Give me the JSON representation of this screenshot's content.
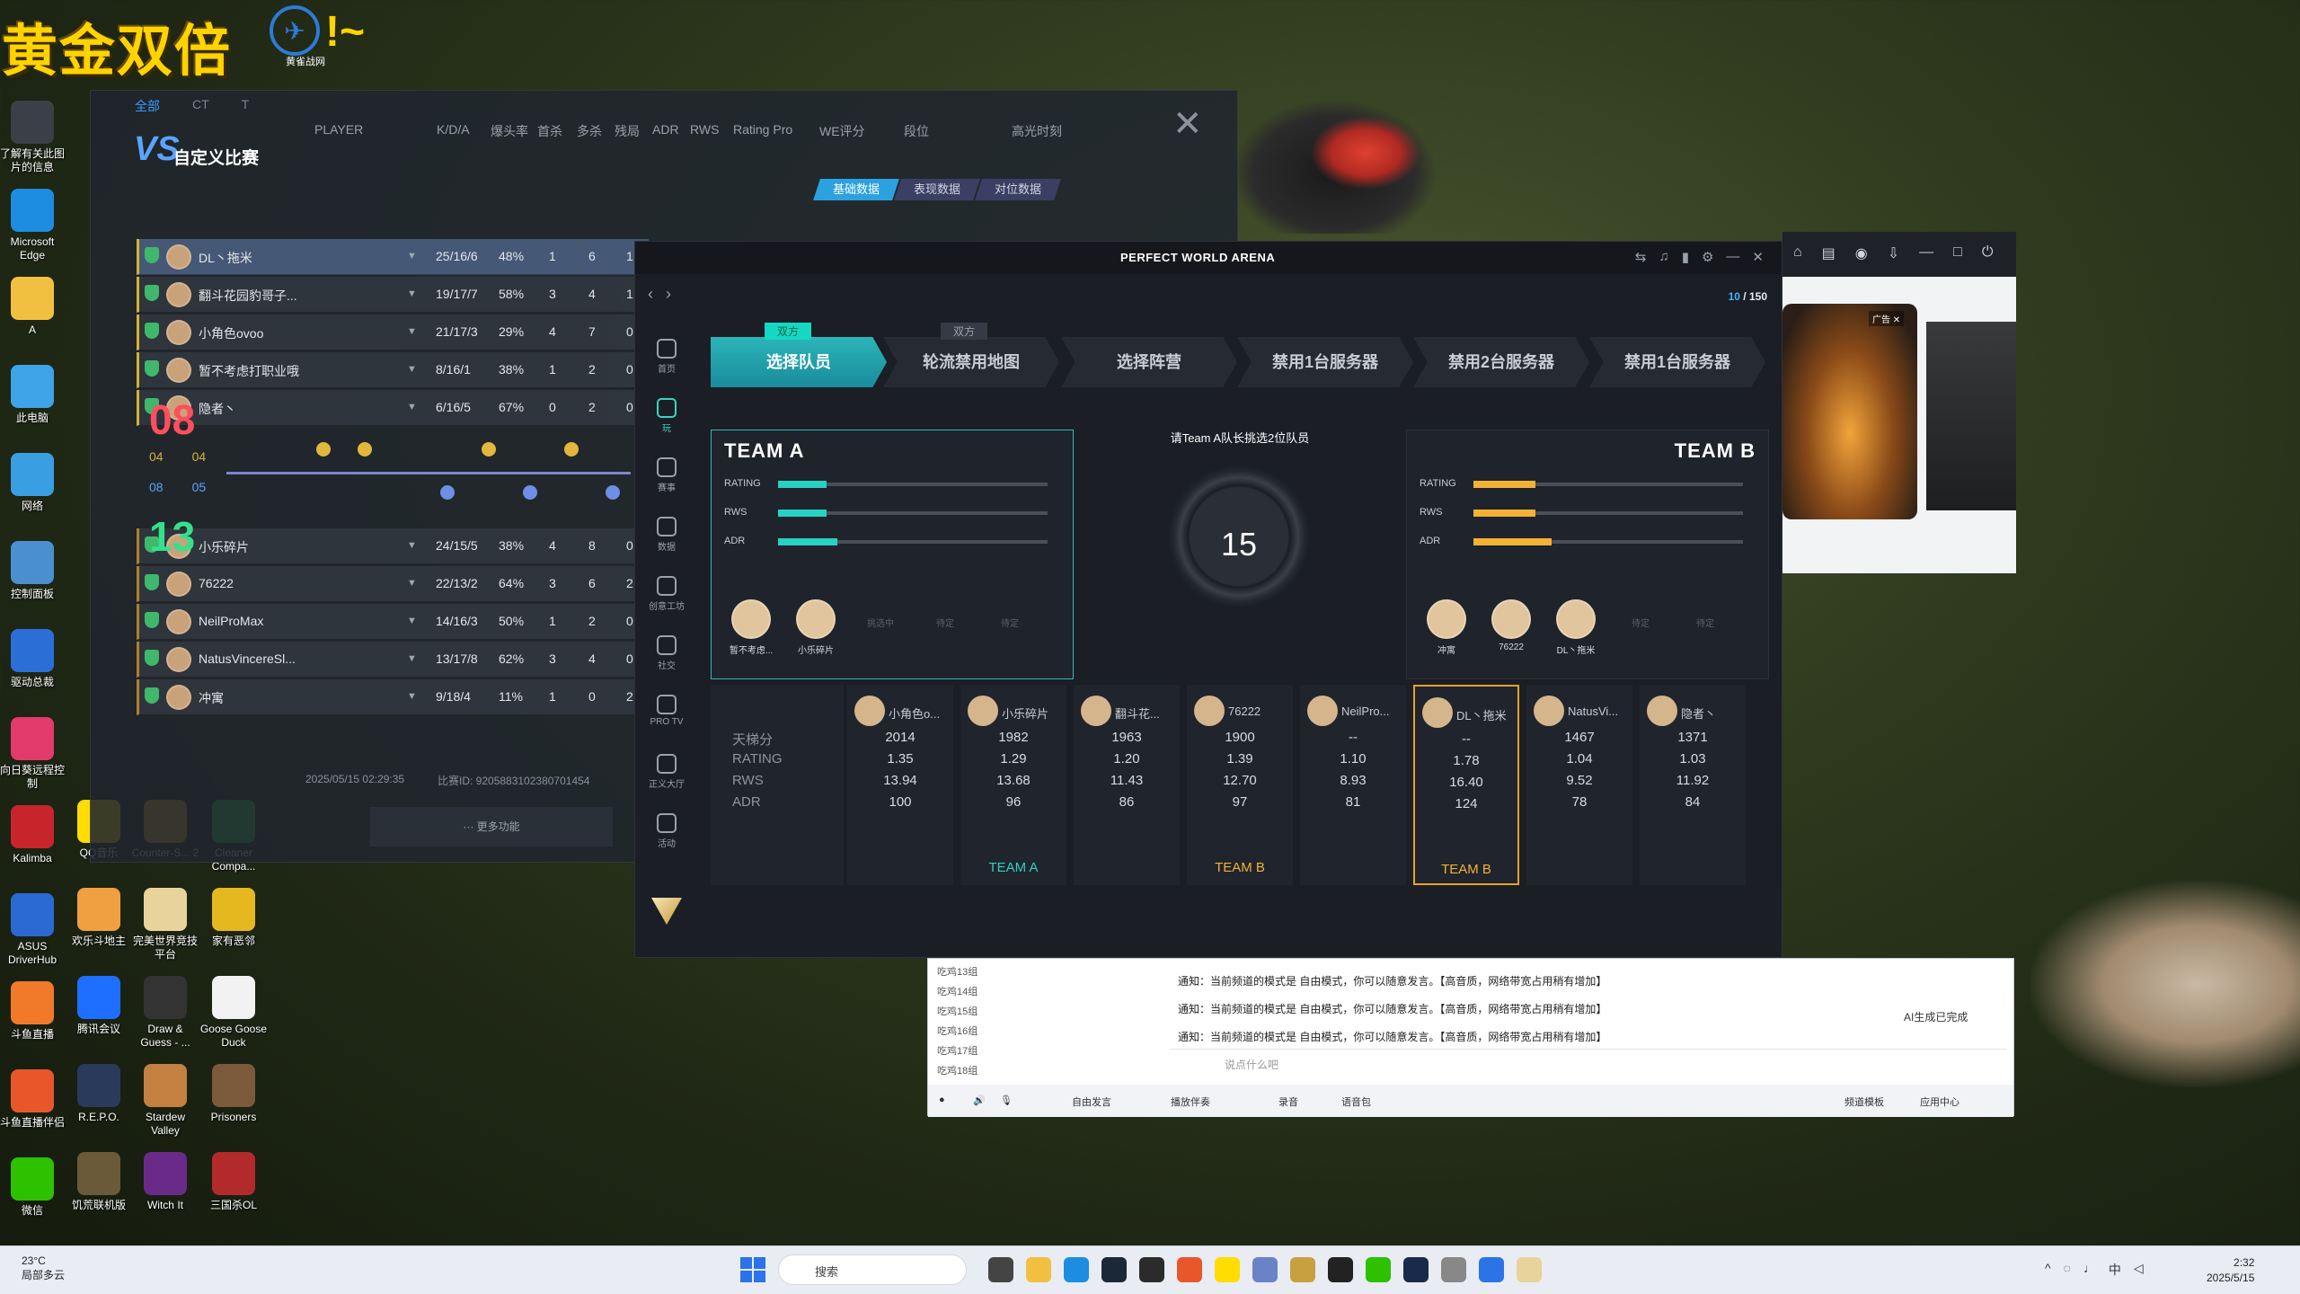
{
  "overlay": {
    "title": "黄金双倍",
    "tilde": "!~",
    "logo_sub": "黄雀战网"
  },
  "desktop_icons": [
    {
      "label": "了解有关此图片的信息",
      "icon": "info-icon",
      "color": "#3a3f48"
    },
    {
      "label": "Microsoft Edge",
      "icon": "edge-icon",
      "color": "#1c8de0"
    },
    {
      "label": "A",
      "icon": "folder-icon",
      "color": "#f2c040"
    },
    {
      "label": "此电脑",
      "icon": "computer-icon",
      "color": "#3fa3e8"
    },
    {
      "label": "网络",
      "icon": "network-icon",
      "color": "#3a9ee2"
    },
    {
      "label": "控制面板",
      "icon": "control-panel-icon",
      "color": "#4a8fd0"
    },
    {
      "label": "驱动总裁",
      "icon": "driver-icon",
      "color": "#2b6fd6"
    },
    {
      "label": "向日葵远程控制",
      "icon": "sunflower-icon",
      "color": "#e23a6a"
    },
    {
      "label": "Kalimba",
      "icon": "kalimba-icon",
      "color": "#c8242c"
    },
    {
      "label": "ASUS DriverHub",
      "icon": "asus-icon",
      "color": "#2a6ad2"
    },
    {
      "label": "斗鱼直播",
      "icon": "douyu-icon",
      "color": "#f07a2a"
    },
    {
      "label": "斗鱼直播伴侣",
      "icon": "douyu-companion-icon",
      "color": "#e8572a"
    },
    {
      "label": "微信",
      "icon": "wechat-icon",
      "color": "#2dc100"
    }
  ],
  "desktop_icons_col2": [
    {
      "label": "QQ音乐",
      "icon": "qqmusic-icon",
      "color": "#ffdd00"
    },
    {
      "label": "欢乐斗地主",
      "icon": "landlord-icon",
      "color": "#f0a040"
    },
    {
      "label": "腾讯会议",
      "icon": "meeting-icon",
      "color": "#1e6fff"
    },
    {
      "label": "R.E.P.O.",
      "icon": "repo-icon",
      "color": "#2a3a5a"
    },
    {
      "label": "饥荒联机版",
      "icon": "dst-icon",
      "color": "#6a5a3a"
    }
  ],
  "desktop_icons_col3": [
    {
      "label": "Counter-S... 2",
      "icon": "cs2-icon",
      "color": "#e4a020"
    },
    {
      "label": "完美世界竞技平台",
      "icon": "pwa-icon",
      "color": "#e8d49a"
    },
    {
      "label": "Draw & Guess - ...",
      "icon": "drawguess-icon",
      "color": "#333"
    },
    {
      "label": "Stardew Valley",
      "icon": "stardew-icon",
      "color": "#c48040"
    },
    {
      "label": "Witch It",
      "icon": "witchit-icon",
      "color": "#6a2a8a"
    }
  ],
  "desktop_icons_col4": [
    {
      "label": "Cleaner Compa...",
      "icon": "cleaner-icon",
      "color": "#36c24a"
    },
    {
      "label": "家有恶邻",
      "icon": "neighbor-icon",
      "color": "#e6b820"
    },
    {
      "label": "Goose Goose Duck",
      "icon": "goose-icon",
      "color": "#f2f2f2"
    },
    {
      "label": "Prisoners",
      "icon": "prisoners-icon",
      "color": "#7a5a3a"
    },
    {
      "label": "三国杀OL",
      "icon": "sgs-icon",
      "color": "#b22a2a"
    }
  ],
  "scoreboard": {
    "logo_text": "自定义比赛",
    "tabs": [
      "基础数据",
      "表现数据",
      "对位数据"
    ],
    "filters": [
      "全部",
      "CT",
      "T"
    ],
    "headers": {
      "player": "PLAYER",
      "kda": "K/D/A",
      "hs": "爆头率",
      "fk": "首杀",
      "mk": "多杀",
      "clutch": "残局",
      "adr": "ADR",
      "rws": "RWS",
      "rating": "Rating Pro",
      "we": "WE评分",
      "rank": "段位",
      "highlight": "高光时刻"
    },
    "team_a_rows": [
      {
        "name": "DL丶拖米",
        "kda": "25/16/6",
        "hs": "48%",
        "fk": "1",
        "mk": "6",
        "clutch": "1"
      },
      {
        "name": "翻斗花园豹哥子...",
        "kda": "19/17/7",
        "hs": "58%",
        "fk": "3",
        "mk": "4",
        "clutch": "1"
      },
      {
        "name": "小角色ovoo",
        "kda": "21/17/3",
        "hs": "29%",
        "fk": "4",
        "mk": "7",
        "clutch": "0"
      },
      {
        "name": "暂不考虑打职业哦",
        "kda": "8/16/1",
        "hs": "38%",
        "fk": "1",
        "mk": "2",
        "clutch": "0"
      },
      {
        "name": "隐者丶",
        "kda": "6/16/5",
        "hs": "67%",
        "fk": "0",
        "mk": "2",
        "clutch": "0"
      }
    ],
    "team_b_rows": [
      {
        "name": "小乐碎片",
        "kda": "24/15/5",
        "hs": "38%",
        "fk": "4",
        "mk": "8",
        "clutch": "0"
      },
      {
        "name": "76222",
        "kda": "22/13/2",
        "hs": "64%",
        "fk": "3",
        "mk": "6",
        "clutch": "2"
      },
      {
        "name": "NeilProMax",
        "kda": "14/16/3",
        "hs": "50%",
        "fk": "1",
        "mk": "2",
        "clutch": "0"
      },
      {
        "name": "NatusVincereSl...",
        "kda": "13/17/8",
        "hs": "62%",
        "fk": "3",
        "mk": "4",
        "clutch": "0"
      },
      {
        "name": "冲寓",
        "kda": "9/18/4",
        "hs": "11%",
        "fk": "1",
        "mk": "0",
        "clutch": "2"
      }
    ],
    "score_a": "08",
    "score_b": "13",
    "half_a": [
      "04",
      "04"
    ],
    "half_b": [
      "08",
      "05"
    ],
    "date": "2025/05/15 02:29:35",
    "match_id": "比赛ID: 9205883102380701454",
    "more": "··· 更多功能"
  },
  "arena": {
    "title": "PERFECT WORLD ARENA",
    "counter_current": "10",
    "counter_total": "/ 150",
    "sidebar": [
      {
        "label": "首页",
        "icon": "home-icon"
      },
      {
        "label": "玩",
        "icon": "play-icon"
      },
      {
        "label": "赛事",
        "icon": "trophy-icon"
      },
      {
        "label": "数据",
        "icon": "data-icon"
      },
      {
        "label": "创意工坊",
        "icon": "workshop-icon"
      },
      {
        "label": "社交",
        "icon": "social-icon"
      },
      {
        "label": "PRO TV",
        "icon": "tv-icon"
      },
      {
        "label": "正义大厅",
        "icon": "justice-icon"
      },
      {
        "label": "活动",
        "icon": "event-icon"
      }
    ],
    "stages": [
      "选择队员",
      "轮流禁用地图",
      "选择阵营",
      "禁用1台服务器",
      "禁用2台服务器",
      "禁用1台服务器"
    ],
    "stage_badge_active": "双方",
    "stage_badge_next": "双方",
    "team_a": {
      "label": "TEAM A",
      "stats": [
        {
          "label": "RATING",
          "value": 0.18
        },
        {
          "label": "RWS",
          "value": 0.18
        },
        {
          "label": "ADR",
          "value": 0.22
        }
      ],
      "slots": [
        "暂不考虑...",
        "小乐碎片",
        "挑选中",
        "待定",
        "待定"
      ]
    },
    "team_b": {
      "label": "TEAM B",
      "stats": [
        {
          "label": "RATING",
          "value": 0.23
        },
        {
          "label": "RWS",
          "value": 0.23
        },
        {
          "label": "ADR",
          "value": 0.29
        }
      ],
      "slots": [
        "冲寓",
        "76222",
        "DL丶拖米",
        "待定",
        "待定"
      ]
    },
    "prompt": "请Team A队长挑选2位队员",
    "timer": "15",
    "stat_labels": [
      "天梯分",
      "RATING",
      "RWS",
      "ADR"
    ],
    "players": [
      {
        "name": "小角色o...",
        "elo": "2014",
        "rating": "1.35",
        "rws": "13.94",
        "adr": "100",
        "team": "",
        "team_color": ""
      },
      {
        "name": "小乐碎片",
        "elo": "1982",
        "rating": "1.29",
        "rws": "13.68",
        "adr": "96",
        "team": "TEAM A",
        "team_color": "#2fd0c4"
      },
      {
        "name": "翻斗花...",
        "elo": "1963",
        "rating": "1.20",
        "rws": "11.43",
        "adr": "86",
        "team": "",
        "team_color": ""
      },
      {
        "name": "76222",
        "elo": "1900",
        "rating": "1.39",
        "rws": "12.70",
        "adr": "97",
        "team": "TEAM B",
        "team_color": "#f2b233"
      },
      {
        "name": "NeilPro...",
        "elo": "--",
        "rating": "1.10",
        "rws": "8.93",
        "adr": "81",
        "team": "",
        "team_color": ""
      },
      {
        "name": "DL丶拖米",
        "elo": "--",
        "rating": "1.78",
        "rws": "16.40",
        "adr": "124",
        "team": "TEAM B",
        "team_color": "#f2b233"
      },
      {
        "name": "NatusVi...",
        "elo": "1467",
        "rating": "1.04",
        "rws": "9.52",
        "adr": "78",
        "team": "",
        "team_color": ""
      },
      {
        "name": "隐者丶",
        "elo": "1371",
        "rating": "1.03",
        "rws": "11.92",
        "adr": "84",
        "team": "",
        "team_color": ""
      }
    ]
  },
  "side_window": {
    "ad_tag": "广告 ✕"
  },
  "chat": {
    "channels": [
      "吃鸡13组",
      "吃鸡14组",
      "吃鸡15组",
      "吃鸡16组",
      "吃鸡17组",
      "吃鸡18组"
    ],
    "notices": [
      "通知：当前频道的模式是 自由模式，你可以随意发言。【高音质，网络带宽占用稍有增加】",
      "通知：当前频道的模式是 自由模式，你可以随意发言。【高音质，网络带宽占用稍有增加】",
      "通知：当前频道的模式是 自由模式，你可以随意发言。【高音质，网络带宽占用稍有增加】"
    ],
    "ai_done": "AI生成已完成",
    "input_placeholder": "说点什么吧",
    "bottom": {
      "free": "自由发言",
      "music": "播放伴奏",
      "record": "录音",
      "voice": "语音包",
      "template": "频道模板",
      "app": "应用中心"
    }
  },
  "taskbar": {
    "weather_temp": "23°C",
    "weather_desc": "局部多云",
    "search": "搜索",
    "time": "2:32",
    "date": "2025/5/15",
    "tray": "中"
  }
}
